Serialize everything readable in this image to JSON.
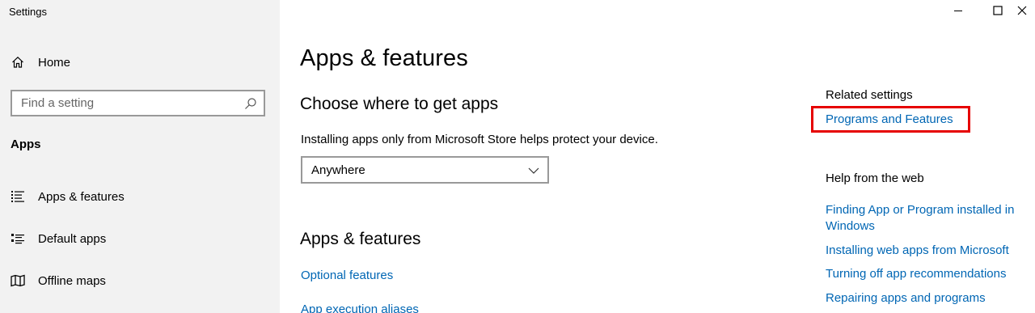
{
  "window": {
    "title": "Settings",
    "controls": {
      "minimize_glyph": "—",
      "maximize_glyph": "☐",
      "close_glyph": "✕"
    }
  },
  "sidebar": {
    "home": {
      "label": "Home",
      "icon": "home-icon"
    },
    "search": {
      "placeholder": "Find a setting",
      "icon": "search-icon"
    },
    "section_title": "Apps",
    "items": [
      {
        "label": "Apps & features",
        "icon": "apps-features-icon"
      },
      {
        "label": "Default apps",
        "icon": "default-apps-icon"
      },
      {
        "label": "Offline maps",
        "icon": "offline-maps-icon"
      }
    ]
  },
  "main": {
    "title": "Apps & features",
    "choose_heading": "Choose where to get apps",
    "choose_description": "Installing apps only from Microsoft Store helps protect your device.",
    "source_dropdown": {
      "selected": "Anywhere",
      "icon": "chevron-down-icon"
    },
    "features_heading": "Apps & features",
    "links": [
      "Optional features",
      "App execution aliases"
    ]
  },
  "related": {
    "heading": "Related settings",
    "programs_link": "Programs and Features",
    "highlight_color": "#e60000",
    "help_heading": "Help from the web",
    "help_links": [
      "Finding App or Program installed in Windows",
      "Installing web apps from Microsoft",
      "Turning off app recommendations",
      "Repairing apps and programs"
    ]
  },
  "colors": {
    "accent_link": "#0066b4",
    "sidebar_bg": "#f2f2f2"
  }
}
